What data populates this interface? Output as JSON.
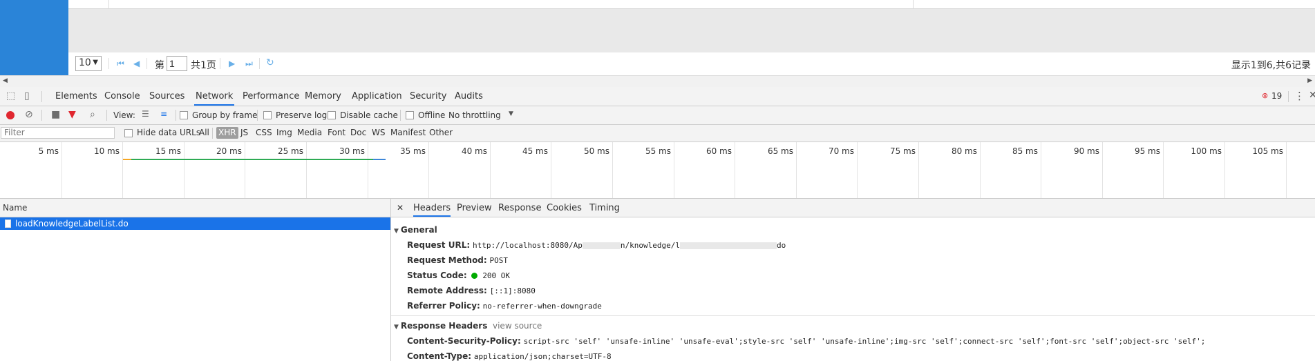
{
  "page": {
    "page_size": "10",
    "page_label_before": "第",
    "page_value": "1",
    "page_total": "共1页",
    "summary": "显示1到6,共6记录"
  },
  "devtools": {
    "tabs": [
      "Elements",
      "Console",
      "Sources",
      "Network",
      "Performance",
      "Memory",
      "Application",
      "Security",
      "Audits"
    ],
    "active_tab": "Network",
    "error_count": "19",
    "toolbar": {
      "view_label": "View:",
      "group_by_frame": "Group by frame",
      "preserve_log": "Preserve log",
      "disable_cache": "Disable cache",
      "offline": "Offline",
      "throttling": "No throttling"
    },
    "filter": {
      "placeholder": "Filter",
      "hide_data_urls": "Hide data URLs",
      "types": [
        "All",
        "XHR",
        "JS",
        "CSS",
        "Img",
        "Media",
        "Font",
        "Doc",
        "WS",
        "Manifest",
        "Other"
      ],
      "active_type": "XHR"
    },
    "timeline_ticks": [
      "5 ms",
      "10 ms",
      "15 ms",
      "20 ms",
      "25 ms",
      "30 ms",
      "35 ms",
      "40 ms",
      "45 ms",
      "50 ms",
      "55 ms",
      "60 ms",
      "65 ms",
      "70 ms",
      "75 ms",
      "80 ms",
      "85 ms",
      "90 ms",
      "95 ms",
      "100 ms",
      "105 ms"
    ],
    "list": {
      "header": "Name",
      "rows": [
        "loadKnowledgeLabelList.do"
      ]
    },
    "details": {
      "tabs": [
        "Headers",
        "Preview",
        "Response",
        "Cookies",
        "Timing"
      ],
      "active_tab": "Headers",
      "general": {
        "title": "General",
        "request_url_key": "Request URL:",
        "request_url_val_a": "http://localhost:8080/Ap",
        "request_url_val_b": "n/knowledge/l",
        "request_url_val_c": "do",
        "request_method_key": "Request Method:",
        "request_method_val": "POST",
        "status_code_key": "Status Code:",
        "status_code_val": "200 OK",
        "remote_address_key": "Remote Address:",
        "remote_address_val": "[::1]:8080",
        "referrer_policy_key": "Referrer Policy:",
        "referrer_policy_val": "no-referrer-when-downgrade"
      },
      "response_headers": {
        "title": "Response Headers",
        "view_source": "view source",
        "csp_key": "Content-Security-Policy:",
        "csp_val": "script-src 'self' 'unsafe-inline' 'unsafe-eval';style-src 'self' 'unsafe-inline';img-src 'self';connect-src 'self';font-src 'self';object-src 'self';",
        "content_type_key": "Content-Type:",
        "content_type_val": "application/json;charset=UTF-8"
      }
    }
  }
}
